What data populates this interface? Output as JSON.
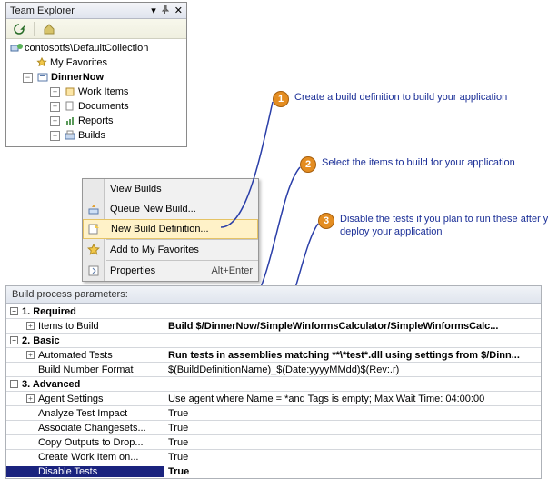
{
  "panel": {
    "title": "Team Explorer",
    "collection": "contosotfs\\DefaultCollection",
    "project": "DinnerNow",
    "favorites": "My Favorites",
    "nodes": {
      "workitems": "Work Items",
      "documents": "Documents",
      "reports": "Reports",
      "builds": "Builds"
    }
  },
  "context_menu": {
    "view_builds": "View Builds",
    "queue": "Queue New Build...",
    "new_def": "New Build Definition...",
    "add_fav": "Add to My Favorites",
    "properties": "Properties",
    "prop_shortcut": "Alt+Enter"
  },
  "callouts": [
    {
      "num": "1",
      "text": "Create a build definition to build your application"
    },
    {
      "num": "2",
      "text": "Select the items to build for your application"
    },
    {
      "num": "3",
      "text": "Disable the tests if you plan to run these after you deploy your application"
    }
  ],
  "grid": {
    "title": "Build process parameters:",
    "sections": {
      "required": "1. Required",
      "basic": "2. Basic",
      "advanced": "3. Advanced"
    },
    "rows": {
      "items_to_build": {
        "k": "Items to Build",
        "v": "Build $/DinnerNow/SimpleWinformsCalculator/SimpleWinformsCalc..."
      },
      "auto_tests": {
        "k": "Automated Tests",
        "v": "Run tests in assemblies matching **\\*test*.dll using settings from $/Dinn..."
      },
      "build_num": {
        "k": "Build Number Format",
        "v": "$(BuildDefinitionName)_$(Date:yyyyMMdd)$(Rev:.r)"
      },
      "agent": {
        "k": "Agent Settings",
        "v": "Use agent where Name = *and Tags is empty; Max Wait Time: 04:00:00"
      },
      "analyze": {
        "k": "Analyze Test Impact",
        "v": "True"
      },
      "assoc": {
        "k": "Associate Changesets...",
        "v": "True"
      },
      "copy": {
        "k": "Copy Outputs to Drop...",
        "v": "True"
      },
      "create_wi": {
        "k": "Create Work Item on...",
        "v": "True"
      },
      "disable": {
        "k": "Disable Tests",
        "v": "True"
      }
    }
  }
}
